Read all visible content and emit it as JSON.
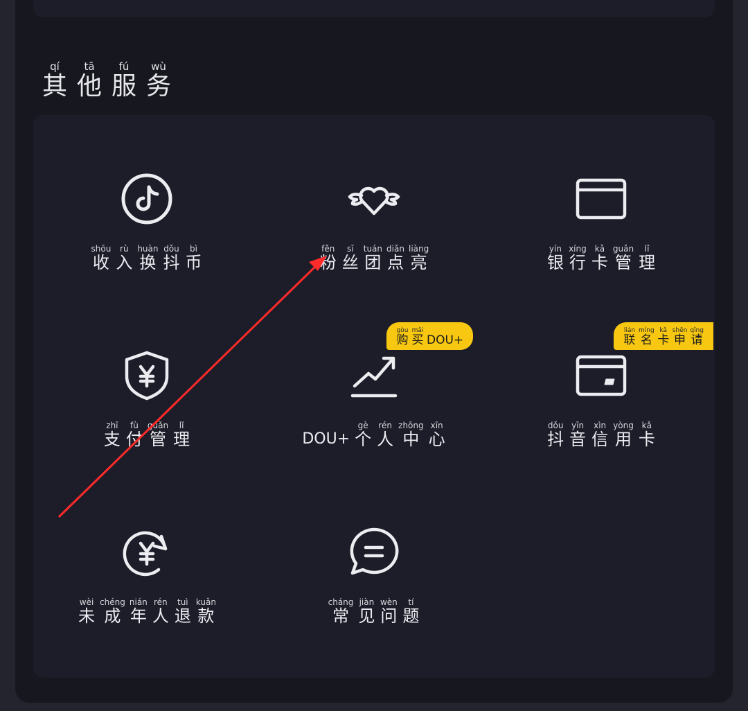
{
  "section": {
    "title": [
      {
        "py": "qí",
        "hz": "其"
      },
      {
        "py": "tā",
        "hz": "他"
      },
      {
        "py": "fú",
        "hz": "服"
      },
      {
        "py": "wù",
        "hz": "务"
      }
    ]
  },
  "tiles": [
    {
      "name": "income-exchange",
      "icon": "douyin-coin-icon",
      "label": [
        {
          "py": "shōu",
          "hz": "收"
        },
        {
          "py": "rù",
          "hz": "入"
        },
        {
          "py": "huàn",
          "hz": "换"
        },
        {
          "py": "dǒu",
          "hz": "抖"
        },
        {
          "py": "bì",
          "hz": "币"
        }
      ]
    },
    {
      "name": "fan-group-light-up",
      "icon": "winged-heart-icon",
      "label": [
        {
          "py": "fěn",
          "hz": "粉"
        },
        {
          "py": "sī",
          "hz": "丝"
        },
        {
          "py": "tuán",
          "hz": "团"
        },
        {
          "py": "diǎn",
          "hz": "点"
        },
        {
          "py": "liàng",
          "hz": "亮"
        }
      ]
    },
    {
      "name": "bank-card-management",
      "icon": "bank-card-icon",
      "label": [
        {
          "py": "yín",
          "hz": "银"
        },
        {
          "py": "xíng",
          "hz": "行"
        },
        {
          "py": "kǎ",
          "hz": "卡"
        },
        {
          "py": "guǎn",
          "hz": "管"
        },
        {
          "py": "lǐ",
          "hz": "理"
        }
      ]
    },
    {
      "name": "payment-management",
      "icon": "yuan-shield-icon",
      "label": [
        {
          "py": "zhī",
          "hz": "支"
        },
        {
          "py": "fù",
          "hz": "付"
        },
        {
          "py": "guǎn",
          "hz": "管"
        },
        {
          "py": "lǐ",
          "hz": "理"
        }
      ]
    },
    {
      "name": "dou-plus-center",
      "icon": "trend-up-icon",
      "badge": [
        {
          "py": "gòu",
          "hz": "购"
        },
        {
          "py": "mǎi",
          "hz": "买"
        },
        {
          "py": "",
          "hz": "DOU+"
        }
      ],
      "label": [
        {
          "py": "",
          "hz": "DOU+"
        },
        {
          "py": "gè",
          "hz": "个"
        },
        {
          "py": "rén",
          "hz": "人"
        },
        {
          "py": "zhōng",
          "hz": "中"
        },
        {
          "py": "xīn",
          "hz": "心"
        }
      ]
    },
    {
      "name": "douyin-credit-card",
      "icon": "credit-card-icon",
      "badge": [
        {
          "py": "lián",
          "hz": "联"
        },
        {
          "py": "míng",
          "hz": "名"
        },
        {
          "py": "kǎ",
          "hz": "卡"
        },
        {
          "py": "shēn",
          "hz": "申"
        },
        {
          "py": "qǐng",
          "hz": "请"
        }
      ],
      "label": [
        {
          "py": "dǒu",
          "hz": "抖"
        },
        {
          "py": "yīn",
          "hz": "音"
        },
        {
          "py": "xìn",
          "hz": "信"
        },
        {
          "py": "yòng",
          "hz": "用"
        },
        {
          "py": "kǎ",
          "hz": "卡"
        }
      ]
    },
    {
      "name": "minor-refund",
      "icon": "yuan-refresh-icon",
      "label": [
        {
          "py": "wèi",
          "hz": "未"
        },
        {
          "py": "chéng",
          "hz": "成"
        },
        {
          "py": "nián",
          "hz": "年"
        },
        {
          "py": "rén",
          "hz": "人"
        },
        {
          "py": "tuì",
          "hz": "退"
        },
        {
          "py": "kuǎn",
          "hz": "款"
        }
      ]
    },
    {
      "name": "faq",
      "icon": "chat-bubble-icon",
      "label": [
        {
          "py": "cháng",
          "hz": "常"
        },
        {
          "py": "jiàn",
          "hz": "见"
        },
        {
          "py": "wèn",
          "hz": "问"
        },
        {
          "py": "tí",
          "hz": "题"
        }
      ]
    }
  ],
  "colors": {
    "background": "#23242d",
    "panel": "#16171f",
    "card": "#1c1d29",
    "text": "#e8e8ec",
    "badge": "#f7c711",
    "annotation_arrow": "#ff2a2a"
  }
}
